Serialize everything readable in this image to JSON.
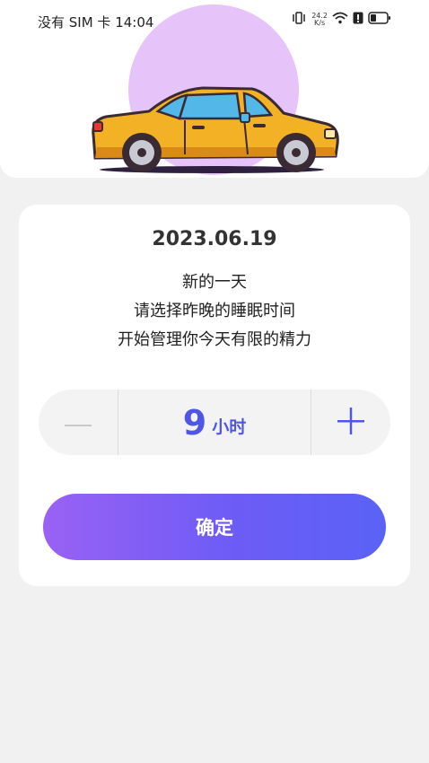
{
  "status_bar": {
    "carrier_time": "没有 SIM 卡 14:04",
    "net_speed_value": "24.2",
    "net_speed_unit": "K/s",
    "icons": [
      "vibrate-icon",
      "wifi-icon",
      "alert-icon",
      "battery-icon"
    ]
  },
  "header": {
    "illustration": "car-icon",
    "circle_color": "#e6c3f8"
  },
  "card": {
    "date": "2023.06.19",
    "line1": "新的一天",
    "line2": "请选择昨晚的睡眠时间",
    "line3": "开始管理你今天有限的精力"
  },
  "stepper": {
    "value": "9",
    "unit": "小时",
    "minus_icon": "minus-icon",
    "plus_icon": "plus-icon"
  },
  "confirm_button": {
    "label": "确定"
  },
  "colors": {
    "accent": "#4f56e6",
    "button_gradient_start": "#9a61f4",
    "button_gradient_end": "#5a62f6",
    "background": "#f1f1f1"
  }
}
